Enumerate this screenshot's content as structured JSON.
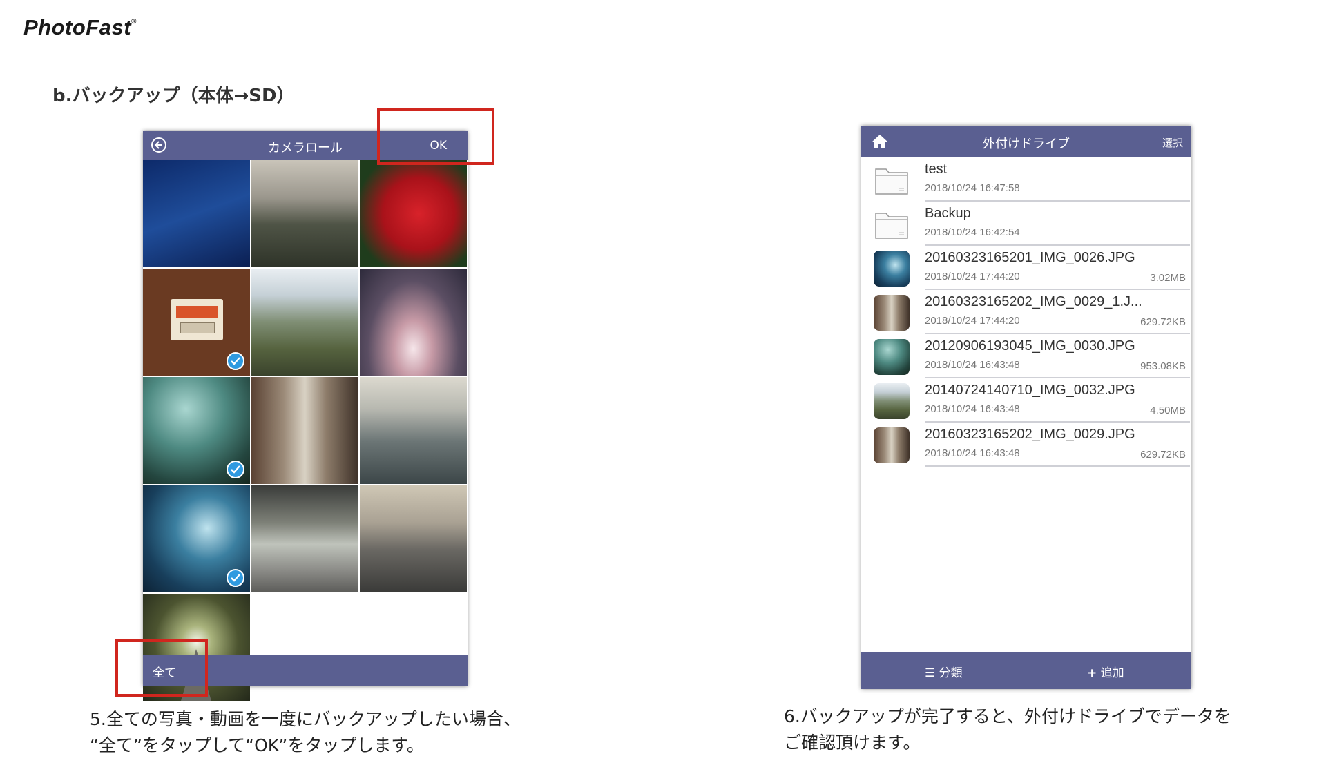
{
  "brand": {
    "logo_text": "PhotoFast",
    "logo_mark": "®"
  },
  "section_title": "b.バックアップ（本体→SD）",
  "camera_roll": {
    "title": "カメラロール",
    "ok_label": "OK",
    "select_all_label": "全て",
    "selected_cells": [
      3,
      6,
      9
    ]
  },
  "caption_left": {
    "line1": "5.全ての写真・動画を一度にバックアップしたい場合、",
    "line2": "“全て”をタップして“OK”をタップします。"
  },
  "external_drive": {
    "title": "外付けドライブ",
    "select_label": "選択",
    "files": [
      {
        "name": "test",
        "date": "2018/10/24 16:47:58",
        "size": "",
        "type": "folder-icon"
      },
      {
        "name": "Backup",
        "date": "2018/10/24 16:42:54",
        "size": "",
        "type": "folder-icon"
      },
      {
        "name": "20160323165201_IMG_0026.JPG",
        "date": "2018/10/24 17:44:20",
        "size": "3.02MB",
        "type": "image"
      },
      {
        "name": "20160323165202_IMG_0029_1.J...",
        "date": "2018/10/24 17:44:20",
        "size": "629.72KB",
        "type": "image"
      },
      {
        "name": "20120906193045_IMG_0030.JPG",
        "date": "2018/10/24 16:43:48",
        "size": "953.08KB",
        "type": "image"
      },
      {
        "name": "20140724140710_IMG_0032.JPG",
        "date": "2018/10/24 16:43:48",
        "size": "4.50MB",
        "type": "image"
      },
      {
        "name": "20160323165202_IMG_0029.JPG",
        "date": "2018/10/24 16:43:48",
        "size": "629.72KB",
        "type": "image"
      }
    ],
    "bottom": {
      "categorize_label": "分類",
      "add_label": "追加"
    }
  },
  "caption_right": {
    "line1": "6.バックアップが完了すると、外付けドライブでデータを",
    "line2": "ご確認頂けます。"
  },
  "colors": {
    "bar": "#5a5f91",
    "highlight": "#d0261e",
    "check": "#2f9ae0"
  }
}
